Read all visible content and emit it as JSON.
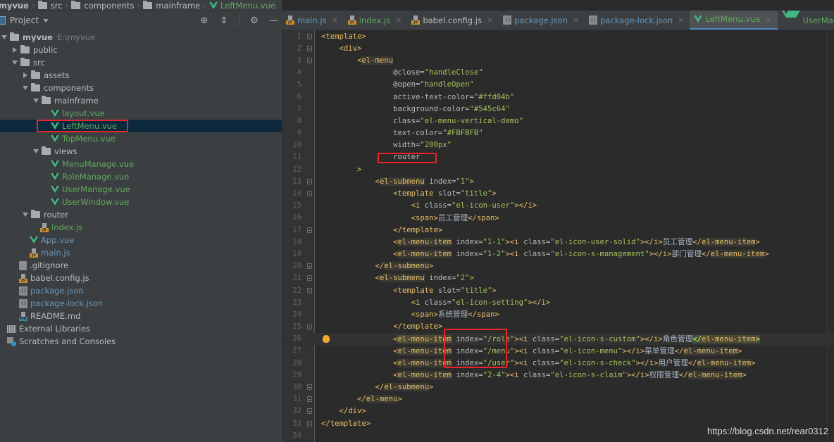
{
  "breadcrumb": [
    {
      "label": "myvue",
      "kind": "root"
    },
    {
      "label": "src",
      "kind": "folder"
    },
    {
      "label": "components",
      "kind": "folder"
    },
    {
      "label": "mainframe",
      "kind": "folder"
    },
    {
      "label": "LeftMenu.vue",
      "kind": "vue"
    }
  ],
  "project_panel": {
    "title": "Project",
    "tools": [
      "locate-icon",
      "collapse-all-icon",
      "gear-icon",
      "minimize-icon"
    ]
  },
  "tree": [
    {
      "label": "myvue",
      "path": "E:\\myvue",
      "depth": 0,
      "arrow": "down",
      "icon": "folder",
      "bold": true
    },
    {
      "label": "public",
      "depth": 1,
      "arrow": "right",
      "icon": "folder"
    },
    {
      "label": "src",
      "depth": 1,
      "arrow": "down",
      "icon": "folder"
    },
    {
      "label": "assets",
      "depth": 2,
      "arrow": "right",
      "icon": "folder"
    },
    {
      "label": "components",
      "depth": 2,
      "arrow": "down",
      "icon": "folder"
    },
    {
      "label": "mainframe",
      "depth": 3,
      "arrow": "down",
      "icon": "folder"
    },
    {
      "label": "layout.vue",
      "depth": 4,
      "arrow": "none",
      "icon": "vue",
      "color": "green"
    },
    {
      "label": "LeftMenu.vue",
      "depth": 4,
      "arrow": "none",
      "icon": "vue",
      "color": "green",
      "selected": true,
      "highlighted": true
    },
    {
      "label": "TopMenu.vue",
      "depth": 4,
      "arrow": "none",
      "icon": "vue",
      "color": "green"
    },
    {
      "label": "views",
      "depth": 3,
      "arrow": "down",
      "icon": "folder"
    },
    {
      "label": "MenuManage.vue",
      "depth": 4,
      "arrow": "none",
      "icon": "vue",
      "color": "green"
    },
    {
      "label": "RoleManage.vue",
      "depth": 4,
      "arrow": "none",
      "icon": "vue",
      "color": "green"
    },
    {
      "label": "UserManage.vue",
      "depth": 4,
      "arrow": "none",
      "icon": "vue",
      "color": "green"
    },
    {
      "label": "UserWindow.vue",
      "depth": 4,
      "arrow": "none",
      "icon": "vue",
      "color": "green"
    },
    {
      "label": "router",
      "depth": 2,
      "arrow": "down",
      "icon": "folder"
    },
    {
      "label": "index.js",
      "depth": 3,
      "arrow": "none",
      "icon": "js",
      "color": "green"
    },
    {
      "label": "App.vue",
      "depth": 2,
      "arrow": "none",
      "icon": "vue",
      "color": "blue"
    },
    {
      "label": "main.js",
      "depth": 2,
      "arrow": "none",
      "icon": "js",
      "color": "blue"
    },
    {
      "label": ".gitignore",
      "depth": 1,
      "arrow": "none",
      "icon": "git"
    },
    {
      "label": "babel.config.js",
      "depth": 1,
      "arrow": "none",
      "icon": "js"
    },
    {
      "label": "package.json",
      "depth": 1,
      "arrow": "none",
      "icon": "json",
      "color": "blue"
    },
    {
      "label": "package-lock.json",
      "depth": 1,
      "arrow": "none",
      "icon": "json",
      "color": "blue"
    },
    {
      "label": "README.md",
      "depth": 1,
      "arrow": "none",
      "icon": "md"
    },
    {
      "label": "External Libraries",
      "depth": 0,
      "arrow": "none",
      "icon": "lib"
    },
    {
      "label": "Scratches and Consoles",
      "depth": 0,
      "arrow": "none",
      "icon": "scratch"
    }
  ],
  "tabs": [
    {
      "label": "main.js",
      "icon": "js",
      "color": "blue"
    },
    {
      "label": "index.js",
      "icon": "js",
      "color": "green"
    },
    {
      "label": "babel.config.js",
      "icon": "js",
      "color": "default"
    },
    {
      "label": "package.json",
      "icon": "json",
      "color": "blue"
    },
    {
      "label": "package-lock.json",
      "icon": "json",
      "color": "blue"
    },
    {
      "label": "LeftMenu.vue",
      "icon": "vue",
      "color": "green",
      "active": true
    },
    {
      "label": "UserManage.vue",
      "icon": "vue",
      "color": "green"
    },
    {
      "label": "U",
      "icon": "vue",
      "color": "green",
      "truncated": true
    }
  ],
  "editor": {
    "current_line": 26,
    "lines": [
      {
        "n": 1,
        "indent": 0,
        "fold": true,
        "tokens": [
          [
            "tag",
            "<template>"
          ]
        ]
      },
      {
        "n": 2,
        "indent": 1,
        "fold": true,
        "tokens": [
          [
            "tag",
            "<div>"
          ]
        ]
      },
      {
        "n": 3,
        "indent": 2,
        "fold": true,
        "tokens": [
          [
            "tag",
            "<"
          ],
          [
            "tagh",
            "el-menu"
          ]
        ]
      },
      {
        "n": 4,
        "indent": 4,
        "tokens": [
          [
            "attr",
            "@close="
          ],
          [
            "val",
            "\"handleClose\""
          ]
        ]
      },
      {
        "n": 5,
        "indent": 4,
        "tokens": [
          [
            "attr",
            "@open="
          ],
          [
            "val",
            "\"handleOpen\""
          ]
        ]
      },
      {
        "n": 6,
        "indent": 4,
        "tokens": [
          [
            "attr",
            "active-text-color="
          ],
          [
            "val",
            "\"#ffd04b\""
          ]
        ]
      },
      {
        "n": 7,
        "indent": 4,
        "tokens": [
          [
            "attr",
            "background-color="
          ],
          [
            "val",
            "\"#545c64\""
          ]
        ]
      },
      {
        "n": 8,
        "indent": 4,
        "tokens": [
          [
            "attr",
            "class="
          ],
          [
            "val",
            "\"el-menu-vertical-demo\""
          ]
        ]
      },
      {
        "n": 9,
        "indent": 4,
        "tokens": [
          [
            "attr",
            "text-color="
          ],
          [
            "val",
            "\"#FBFBFB\""
          ]
        ]
      },
      {
        "n": 10,
        "indent": 4,
        "tokens": [
          [
            "attr",
            "width="
          ],
          [
            "val",
            "\"200px\""
          ]
        ]
      },
      {
        "n": 11,
        "indent": 4,
        "tokens": [
          [
            "attr",
            "router"
          ]
        ],
        "boxed": true
      },
      {
        "n": 12,
        "indent": 2,
        "tokens": [
          [
            "tag",
            ">"
          ]
        ]
      },
      {
        "n": 13,
        "indent": 3,
        "fold": true,
        "tokens": [
          [
            "tag",
            "<"
          ],
          [
            "tagh",
            "el-submenu"
          ],
          [
            "attr",
            " index="
          ],
          [
            "val",
            "\"1\""
          ],
          [
            "tag",
            ">"
          ]
        ]
      },
      {
        "n": 14,
        "indent": 4,
        "fold": true,
        "tokens": [
          [
            "tag",
            "<template"
          ],
          [
            "attr",
            " slot="
          ],
          [
            "val",
            "\"title\""
          ],
          [
            "tag",
            ">"
          ]
        ]
      },
      {
        "n": 15,
        "indent": 5,
        "tokens": [
          [
            "tag",
            "<i"
          ],
          [
            "attr",
            " class="
          ],
          [
            "val",
            "\"el-icon-user\""
          ],
          [
            "tag",
            "></i>"
          ]
        ]
      },
      {
        "n": 16,
        "indent": 5,
        "tokens": [
          [
            "tag",
            "<span>"
          ],
          [
            "txt",
            "员工管理"
          ],
          [
            "tag",
            "</span>"
          ]
        ]
      },
      {
        "n": 17,
        "indent": 4,
        "fold": true,
        "tokens": [
          [
            "tag",
            "</template>"
          ]
        ]
      },
      {
        "n": 18,
        "indent": 4,
        "tokens": [
          [
            "tag",
            "<"
          ],
          [
            "tagh",
            "el-menu-item"
          ],
          [
            "attr",
            " index="
          ],
          [
            "val",
            "\"1-1\""
          ],
          [
            "tag",
            "><i"
          ],
          [
            "attr",
            " class="
          ],
          [
            "val",
            "\"el-icon-user-solid\""
          ],
          [
            "tag",
            "></i>"
          ],
          [
            "txt",
            "员工管理"
          ],
          [
            "tag",
            "</"
          ],
          [
            "tagh",
            "el-menu-item"
          ],
          [
            "tag",
            ">"
          ]
        ]
      },
      {
        "n": 19,
        "indent": 4,
        "tokens": [
          [
            "tag",
            "<"
          ],
          [
            "tagh",
            "el-menu-item"
          ],
          [
            "attr",
            " index="
          ],
          [
            "val",
            "\"1-2\""
          ],
          [
            "tag",
            "><i"
          ],
          [
            "attr",
            " class="
          ],
          [
            "val",
            "\"el-icon-s-management\""
          ],
          [
            "tag",
            "></i>"
          ],
          [
            "txt",
            "部门管理"
          ],
          [
            "tag",
            "</"
          ],
          [
            "tagh",
            "el-menu-item"
          ],
          [
            "tag",
            ">"
          ]
        ]
      },
      {
        "n": 20,
        "indent": 3,
        "fold": true,
        "tokens": [
          [
            "tag",
            "</"
          ],
          [
            "tagh",
            "el-submenu"
          ],
          [
            "tag",
            ">"
          ]
        ]
      },
      {
        "n": 21,
        "indent": 3,
        "fold": true,
        "tokens": [
          [
            "tag",
            "<"
          ],
          [
            "tagh",
            "el-submenu"
          ],
          [
            "attr",
            " index="
          ],
          [
            "val",
            "\"2\""
          ],
          [
            "tag",
            ">"
          ]
        ]
      },
      {
        "n": 22,
        "indent": 4,
        "fold": true,
        "tokens": [
          [
            "tag",
            "<template"
          ],
          [
            "attr",
            " slot="
          ],
          [
            "val",
            "\"title\""
          ],
          [
            "tag",
            ">"
          ]
        ]
      },
      {
        "n": 23,
        "indent": 5,
        "tokens": [
          [
            "tag",
            "<i"
          ],
          [
            "attr",
            " class="
          ],
          [
            "val",
            "\"el-icon-setting\""
          ],
          [
            "tag",
            "></i>"
          ]
        ]
      },
      {
        "n": 24,
        "indent": 5,
        "tokens": [
          [
            "tag",
            "<span>"
          ],
          [
            "txt",
            "系统管理"
          ],
          [
            "tag",
            "</span>"
          ]
        ]
      },
      {
        "n": 25,
        "indent": 4,
        "fold": true,
        "tokens": [
          [
            "tag",
            "</template>"
          ]
        ]
      },
      {
        "n": 26,
        "indent": 4,
        "bulb": true,
        "tokens": [
          [
            "tag",
            "<"
          ],
          [
            "tagh2",
            "el-menu-item"
          ],
          [
            "attr",
            " index="
          ],
          [
            "val",
            "\"/role\""
          ],
          [
            "tag",
            "><i"
          ],
          [
            "attr",
            " class="
          ],
          [
            "val",
            "\"el-icon-s-custom\""
          ],
          [
            "tag",
            "></i>"
          ],
          [
            "txt",
            "角色管理"
          ],
          [
            "matched",
            "</"
          ],
          [
            "tagh2",
            "el-menu-item"
          ],
          [
            "matched",
            ">"
          ]
        ]
      },
      {
        "n": 27,
        "indent": 4,
        "tokens": [
          [
            "tag",
            "<"
          ],
          [
            "tagh",
            "el-menu-item"
          ],
          [
            "attr",
            " index="
          ],
          [
            "val",
            "\"/menu\""
          ],
          [
            "tag",
            "><i"
          ],
          [
            "attr",
            " class="
          ],
          [
            "val",
            "\"el-icon-menu\""
          ],
          [
            "tag",
            "></i>"
          ],
          [
            "txt",
            "菜单管理"
          ],
          [
            "tag",
            "</"
          ],
          [
            "tagh",
            "el-menu-item"
          ],
          [
            "tag",
            ">"
          ]
        ]
      },
      {
        "n": 28,
        "indent": 4,
        "tokens": [
          [
            "tag",
            "<"
          ],
          [
            "tagh",
            "el-menu-item"
          ],
          [
            "attr",
            " index="
          ],
          [
            "val",
            "\"/user\""
          ],
          [
            "tag",
            "><i"
          ],
          [
            "attr",
            " class="
          ],
          [
            "val",
            "\"el-icon-s-check\""
          ],
          [
            "tag",
            "></i>"
          ],
          [
            "txt",
            "用户管理"
          ],
          [
            "tag",
            "</"
          ],
          [
            "tagh",
            "el-menu-item"
          ],
          [
            "tag",
            ">"
          ]
        ]
      },
      {
        "n": 29,
        "indent": 4,
        "tokens": [
          [
            "tag",
            "<"
          ],
          [
            "tagh",
            "el-menu-item"
          ],
          [
            "attr",
            " index="
          ],
          [
            "val",
            "\"2-4\""
          ],
          [
            "tag",
            "><i"
          ],
          [
            "attr",
            " class="
          ],
          [
            "val",
            "\"el-icon-s-claim\""
          ],
          [
            "tag",
            "></i>"
          ],
          [
            "txt",
            "权限管理"
          ],
          [
            "tag",
            "</"
          ],
          [
            "tagh",
            "el-menu-item"
          ],
          [
            "tag",
            ">"
          ]
        ]
      },
      {
        "n": 30,
        "indent": 3,
        "fold": true,
        "tokens": [
          [
            "tag",
            "</"
          ],
          [
            "tagh",
            "el-submenu"
          ],
          [
            "tag",
            ">"
          ]
        ]
      },
      {
        "n": 31,
        "indent": 2,
        "fold": true,
        "tokens": [
          [
            "tag",
            "</"
          ],
          [
            "tagh",
            "el-menu"
          ],
          [
            "tag",
            ">"
          ]
        ]
      },
      {
        "n": 32,
        "indent": 1,
        "fold": true,
        "tokens": [
          [
            "tag",
            "</div>"
          ]
        ]
      },
      {
        "n": 33,
        "indent": 0,
        "fold": true,
        "tokens": [
          [
            "tag",
            "</template>"
          ]
        ]
      },
      {
        "n": 34,
        "indent": 0,
        "tokens": []
      }
    ]
  },
  "watermark": "https://blog.csdn.net/rear0312",
  "colors": {
    "highlight_box": "#e8262a",
    "vue_green": "#41b883",
    "selection": "#0d293e"
  }
}
